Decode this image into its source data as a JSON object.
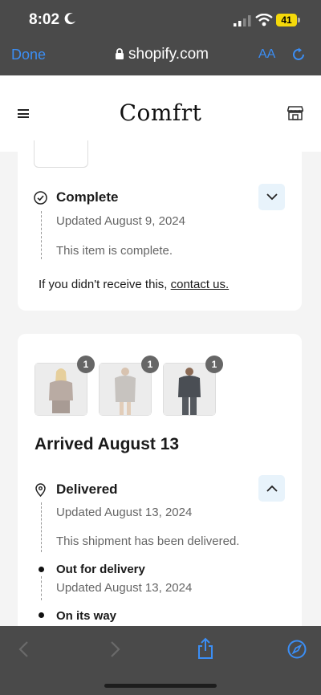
{
  "status_bar": {
    "time": "8:02",
    "battery": "41"
  },
  "browser": {
    "done_label": "Done",
    "url": "shopify.com",
    "text_size_label": "AA"
  },
  "site": {
    "logo": "Comfrt"
  },
  "card1": {
    "status_title": "Complete",
    "updated": "Updated August 9, 2024",
    "note": "This item is complete.",
    "help_prefix": "If you didn't receive this,",
    "help_link": "contact us."
  },
  "card2": {
    "products": [
      {
        "name": "product-hoodie-beige",
        "qty": "1"
      },
      {
        "name": "product-hoodie-grey",
        "qty": "1"
      },
      {
        "name": "product-hoodie-charcoal",
        "qty": "1"
      }
    ],
    "heading": "Arrived August 13",
    "status_title": "Delivered",
    "updated": "Updated August 13, 2024",
    "note": "This shipment has been delivered.",
    "steps": [
      {
        "title": "Out for delivery",
        "updated": "Updated August 13, 2024"
      },
      {
        "title": "On its way"
      }
    ]
  },
  "colors": {
    "accent": "#3b8ef5",
    "toggle_bg": "#e8f3fb",
    "chrome": "#4a4a4a"
  },
  "icons": [
    "moon-icon",
    "signal-icon",
    "wifi-icon",
    "lock-icon",
    "reload-icon",
    "menu-icon",
    "store-icon",
    "check-circle-icon",
    "chevron-down-icon",
    "location-pin-icon",
    "chevron-up-icon",
    "back-icon",
    "forward-icon",
    "share-icon",
    "compass-icon"
  ]
}
